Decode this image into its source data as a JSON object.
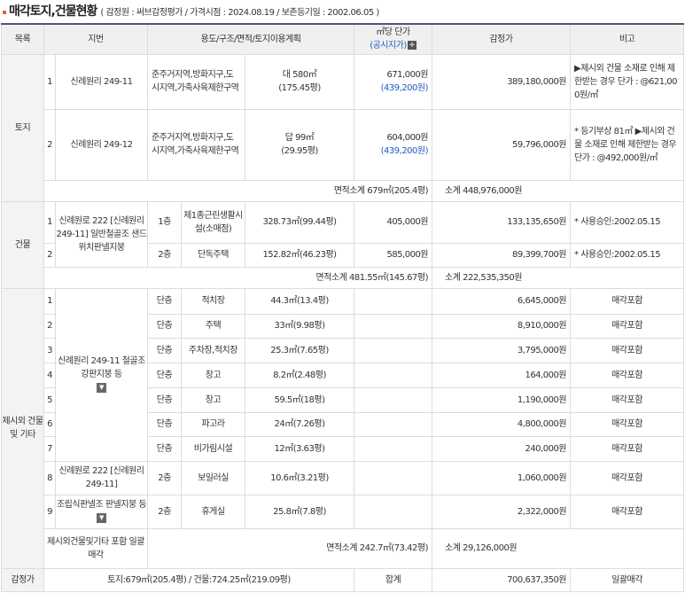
{
  "title": "매각토지,건물현황",
  "subtitle": "( 감정원 : 써브감정평가 / 가격시점 : 2024.08.19 / 보존등기일 : 2002.06.05 )",
  "headers": {
    "col1": "목록",
    "col2": "지번",
    "col3": "용도/구조/면적/토지이용계획",
    "col4_line1": "㎡당 단가",
    "col4_line2": "(공시지가)",
    "col5": "감정가",
    "col6": "비고"
  },
  "land": {
    "label": "토지",
    "rows": [
      {
        "no": "1",
        "lot": "신례원리 249-11",
        "zone": "준주거지역,방화지구,도시지역,가축사육제한구역",
        "area": "대 580㎡",
        "area2": "(175.45평)",
        "unit": "671,000원",
        "official": "(439,200원)",
        "value": "389,180,000원",
        "note": "▶제시외 건물 소재로 인해 제한받는 경우 단가 : @621,000원/㎡"
      },
      {
        "no": "2",
        "lot": "신례원리 249-12",
        "zone": "준주거지역,방화지구,도시지역,가축사육제한구역",
        "area": "답 99㎡",
        "area2": "(29.95평)",
        "unit": "604,000원",
        "official": "(439,200원)",
        "value": "59,796,000원",
        "note": "* 등기부상 81㎡ ▶제시외 건물 소재로 인해 제한받는 경우 단가 : @492,000원/㎡"
      }
    ],
    "subtotal_area": "면적소계 679㎡(205.4평)",
    "subtotal_value": "소계 448,976,000원"
  },
  "building": {
    "label": "건물",
    "lot": "신례원로 222 [신례원리 249-11] 일반철골조 샌드위치판넬지붕",
    "rows": [
      {
        "no": "1",
        "floor": "1층",
        "use": "제1종근린생활시설(소매점)",
        "area": "328.73㎡(99.44평)",
        "unit": "405,000원",
        "value": "133,135,650원",
        "note": "* 사용승인:2002.05.15"
      },
      {
        "no": "2",
        "floor": "2층",
        "use": "단독주택",
        "area": "152.82㎡(46.23평)",
        "unit": "585,000원",
        "value": "89,399,700원",
        "note": "* 사용승인:2002.05.15"
      }
    ],
    "subtotal_area": "면적소계 481.55㎡(145.67평)",
    "subtotal_value": "소계 222,535,350원"
  },
  "extra": {
    "label": "제시외 건물및 기타",
    "lot_a": "신례원리 249-11 철골조 강판지붕 등",
    "lot_b1": "신례원로 222 [신례원리 249-11]",
    "lot_b2": "조립식판넬조 판넬지붕 등",
    "rows": [
      {
        "no": "1",
        "floor": "단층",
        "use": "적치장",
        "area": "44.3㎡(13.4평)",
        "value": "6,645,000원",
        "note": "매각포함"
      },
      {
        "no": "2",
        "floor": "단층",
        "use": "주택",
        "area": "33㎡(9.98평)",
        "value": "8,910,000원",
        "note": "매각포함"
      },
      {
        "no": "3",
        "floor": "단층",
        "use": "주차장,적치장",
        "area": "25.3㎡(7.65평)",
        "value": "3,795,000원",
        "note": "매각포함"
      },
      {
        "no": "4",
        "floor": "단층",
        "use": "창고",
        "area": "8.2㎡(2.48평)",
        "value": "164,000원",
        "note": "매각포함"
      },
      {
        "no": "5",
        "floor": "단층",
        "use": "창고",
        "area": "59.5㎡(18평)",
        "value": "1,190,000원",
        "note": "매각포함"
      },
      {
        "no": "6",
        "floor": "단층",
        "use": "파고라",
        "area": "24㎡(7.26평)",
        "value": "4,800,000원",
        "note": "매각포함"
      },
      {
        "no": "7",
        "floor": "단층",
        "use": "비가림시설",
        "area": "12㎡(3.63평)",
        "value": "240,000원",
        "note": "매각포함"
      },
      {
        "no": "8",
        "floor": "2층",
        "use": "보일러실",
        "area": "10.6㎡(3.21평)",
        "value": "1,060,000원",
        "note": "매각포함"
      },
      {
        "no": "9",
        "floor": "2층",
        "use": "휴게실",
        "area": "25.8㎡(7.8평)",
        "value": "2,322,000원",
        "note": "매각포함"
      }
    ],
    "subtotal_label": "제시외건물및기타 포함 일괄매각",
    "subtotal_area": "면적소계 242.7㎡(73.42평)",
    "subtotal_value": "소계 29,126,000원"
  },
  "total": {
    "label": "감정가",
    "areas": "토지:679㎡(205.4평) / 건물:724.25㎡(219.09평)",
    "sum_label": "합계",
    "sum_value": "700,637,350원",
    "note": "일괄매각"
  }
}
